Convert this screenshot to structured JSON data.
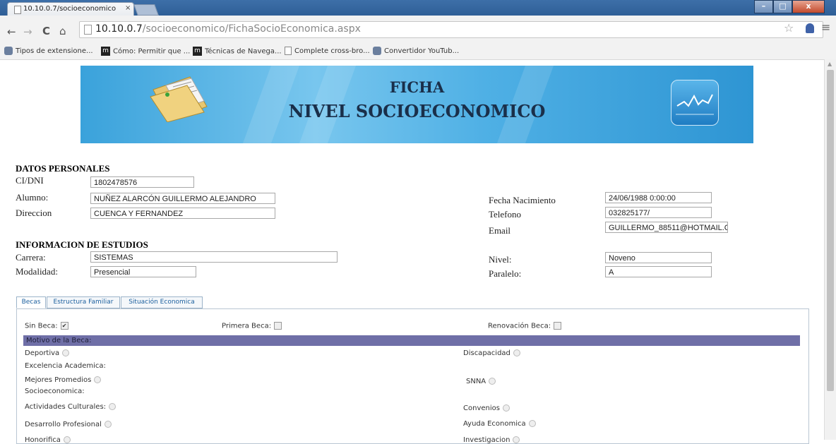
{
  "browser": {
    "tab_title": "10.10.0.7/socioeconomico",
    "tab_close": "×",
    "url_host": "10.10.0.7",
    "url_path": "/socioeconomico/FichaSocioEconomica.aspx",
    "bookmarks": [
      {
        "label": "Tipos de extensione...",
        "icon": "puzzle-icon"
      },
      {
        "label": "Cómo: Permitir que ...",
        "icon": "m-icon"
      },
      {
        "label": "Técnicas de Navega...",
        "icon": "m-icon"
      },
      {
        "label": "Complete cross-bro...",
        "icon": "doc-icon"
      },
      {
        "label": "Convertidor YouTub...",
        "icon": "puzzle-icon"
      }
    ]
  },
  "banner": {
    "title_line1": "FICHA",
    "title_line2": "NIVEL SOCIOECONOMICO"
  },
  "personal": {
    "heading": "DATOS PERSONALES",
    "ci_label": "CI/DNI",
    "ci_value": "1802478576",
    "alumno_label": "Alumno:",
    "alumno_value": "NUÑEZ ALARCÓN  GUILLERMO ALEJANDRO",
    "direccion_label": "Direccion",
    "direccion_value": "CUENCA Y FERNANDEZ",
    "fecha_label": "Fecha Nacimiento",
    "fecha_value": "24/06/1988 0:00:00",
    "telefono_label": "Telefono",
    "telefono_value": "032825177/",
    "email_label": "Email",
    "email_value": "GUILLERMO_88511@HOTMAIL.C"
  },
  "estudios": {
    "heading": "INFORMACION DE ESTUDIOS",
    "carrera_label": "Carrera:",
    "carrera_value": "SISTEMAS",
    "modalidad_label": "Modalidad:",
    "modalidad_value": "Presencial",
    "nivel_label": "Nivel:",
    "nivel_value": "Noveno",
    "paralelo_label": "Paralelo:",
    "paralelo_value": "A"
  },
  "tabs": [
    "Becas",
    "Estructura Familiar",
    "Situación Economica"
  ],
  "becas": {
    "sin_beca_label": "Sin Beca:",
    "sin_beca_checked": true,
    "primera_beca_label": "Primera Beca:",
    "renovacion_label": "Renovación Beca:",
    "motivo_heading": "Motivo de la Beca:",
    "left_options": [
      "Deportiva",
      "Excelencia Academica:",
      "Mejores Promedios",
      "Socioeconomica:",
      "Actividades Culturales:",
      "Desarrollo Profesional",
      "Honorifica"
    ],
    "right_options": [
      "Discapacidad",
      "SNNA",
      "Convenios",
      "Ayuda Economica",
      "Investigacion"
    ]
  },
  "colors": {
    "banner_blue": "#3aa2db",
    "motivo_bar": "#6f6fa7",
    "tab_text": "#1b5f9e"
  }
}
